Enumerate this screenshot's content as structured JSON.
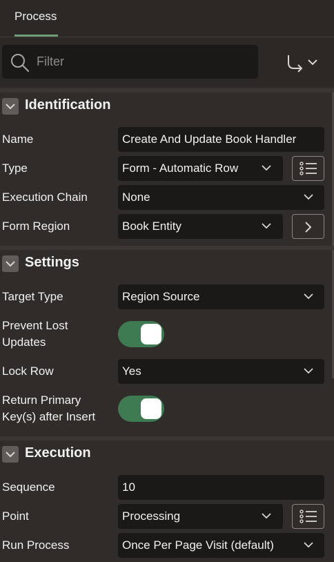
{
  "tabs": [
    {
      "label": "Process",
      "active": true
    }
  ],
  "filter": {
    "placeholder": "Filter"
  },
  "sections": {
    "identification": {
      "title": "Identification",
      "name_label": "Name",
      "name_value": "Create And Update Book Handler",
      "type_label": "Type",
      "type_value": "Form - Automatic Row",
      "chain_label": "Execution Chain",
      "chain_value": "None",
      "region_label": "Form Region",
      "region_value": "Book Entity"
    },
    "settings": {
      "title": "Settings",
      "target_label": "Target Type",
      "target_value": "Region Source",
      "prevent_label_1": "Prevent Lost",
      "prevent_label_2": "Updates",
      "prevent_on": true,
      "lock_label": "Lock Row",
      "lock_value": "Yes",
      "return_label_1": "Return Primary",
      "return_label_2": "Key(s) after Insert",
      "return_on": true
    },
    "execution": {
      "title": "Execution",
      "sequence_label": "Sequence",
      "sequence_value": "10",
      "point_label": "Point",
      "point_value": "Processing",
      "run_label": "Run Process",
      "run_value": "Once Per Page Visit (default)"
    }
  },
  "colors": {
    "background": "#2f2c2a",
    "field": "#1b1918",
    "toggle_on": "#3e7a52",
    "tab_accent": "#6f9e76"
  },
  "icons": {
    "filter": "search-icon",
    "goto": "go-to-component-icon",
    "list": "list-icon",
    "navigate": "chevron-right-icon",
    "collapse": "chevron-down-icon"
  }
}
